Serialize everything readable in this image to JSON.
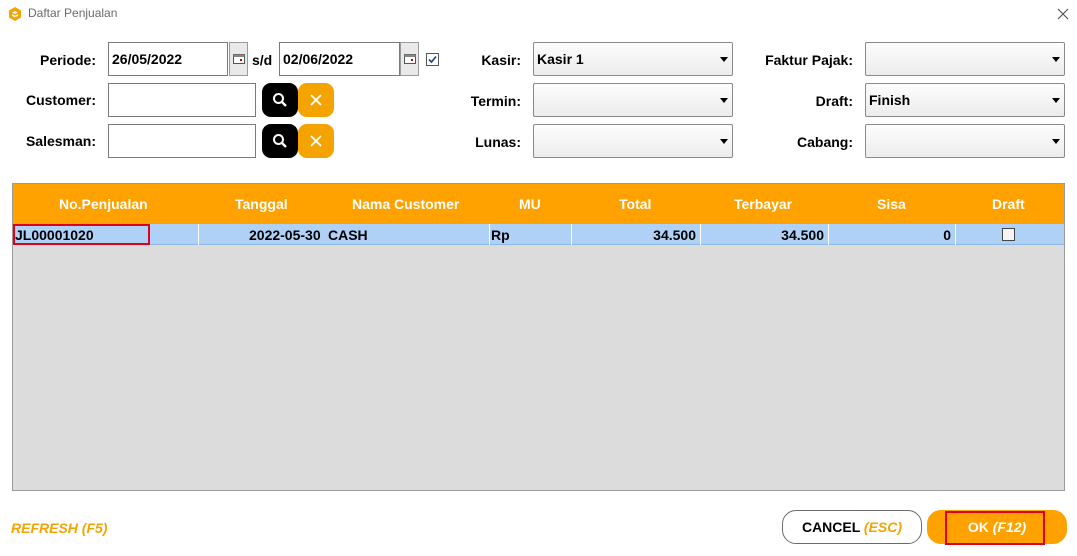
{
  "window": {
    "title": "Daftar Penjualan",
    "accent": "#ffa200",
    "icon": "app-logo-icon"
  },
  "filters": {
    "periode_label": "Periode:",
    "date_from": "26/05/2022",
    "sd_label": "s/d",
    "date_to": "02/06/2022",
    "customer_label": "Customer:",
    "customer_value": "",
    "salesman_label": "Salesman:",
    "salesman_value": "",
    "kasir_label": "Kasir:",
    "kasir_value": "Kasir 1",
    "termin_label": "Termin:",
    "termin_value": "",
    "lunas_label": "Lunas:",
    "lunas_value": "",
    "faktur_label": "Faktur Pajak:",
    "faktur_value": "",
    "draft_label": "Draft:",
    "draft_value": "Finish",
    "cabang_label": "Cabang:",
    "cabang_value": ""
  },
  "grid": {
    "columns": [
      "No.Penjualan",
      "Tanggal",
      "Nama Customer",
      "MU",
      "Total",
      "Terbayar",
      "Sisa",
      "Draft"
    ],
    "rows": [
      {
        "no": "JL00001020",
        "tanggal": "2022-05-30",
        "customer": "CASH",
        "mu": "Rp",
        "total": "34.500",
        "terbayar": "34.500",
        "sisa": "0",
        "draft": false
      }
    ]
  },
  "footer": {
    "refresh": "REFRESH (F5)",
    "cancel_label": "CANCEL",
    "cancel_key": "(ESC)",
    "ok_label": "OK",
    "ok_key": "(F12)"
  }
}
